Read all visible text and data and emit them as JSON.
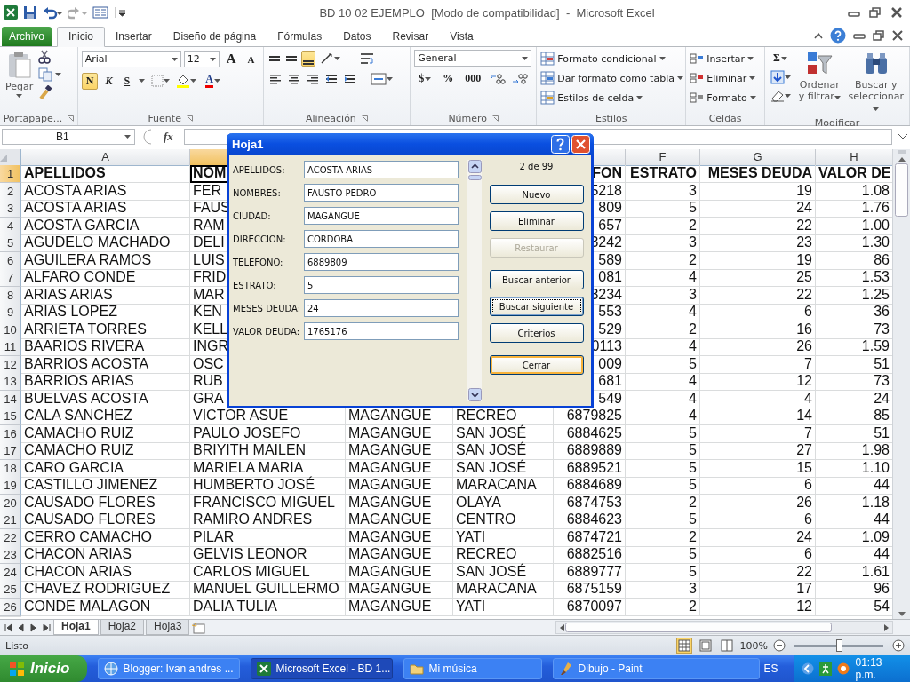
{
  "window": {
    "title": "BD 10 02 EJEMPLO  [Modo de compatibilidad]  -  Microsoft Excel"
  },
  "ribbon_tabs": [
    {
      "label": "Archivo",
      "kind": "file"
    },
    {
      "label": "Inicio",
      "kind": "tab",
      "selected": true
    },
    {
      "label": "Insertar",
      "kind": "tab",
      "selected": false
    },
    {
      "label": "Diseño de página",
      "kind": "tab",
      "selected": false
    },
    {
      "label": "Fórmulas",
      "kind": "tab",
      "selected": false
    },
    {
      "label": "Datos",
      "kind": "tab",
      "selected": false
    },
    {
      "label": "Revisar",
      "kind": "tab",
      "selected": false
    },
    {
      "label": "Vista",
      "kind": "tab",
      "selected": false
    }
  ],
  "ribbon": {
    "clipboard": {
      "label": "Portapape...",
      "paste": "Pegar"
    },
    "font": {
      "label": "Fuente",
      "name": "Arial",
      "size": "12",
      "grow": "A",
      "shrink": "A",
      "bold": "N",
      "bold_on": true,
      "italic": "K",
      "underline": "S",
      "color_glyph": "A"
    },
    "alignment": {
      "label": "Alineación",
      "bottom_align_on": true
    },
    "number": {
      "label": "Número",
      "format": "General",
      "currency": "$",
      "percent": "%",
      "thousands": "000"
    },
    "styles": {
      "label": "Estilos",
      "items": [
        "Formato condicional",
        "Dar formato como tabla",
        "Estilos de celda"
      ]
    },
    "cells": {
      "label": "Celdas",
      "items": [
        "Insertar",
        "Eliminar",
        "Formato"
      ]
    },
    "editing": {
      "label": "Modificar",
      "sum": "Σ",
      "sort": "Ordenar y filtrar",
      "find": "Buscar y seleccionar"
    }
  },
  "formula_bar": {
    "name_box": "B1",
    "function_label": "fx"
  },
  "sheet": {
    "columns": [
      {
        "label": "A",
        "selected": false
      },
      {
        "selected": true
      },
      {},
      {},
      {
        "selected": false
      },
      {
        "label": "F",
        "selected": false
      },
      {
        "label": "G",
        "selected": false
      },
      {
        "label": "H",
        "selected": false
      }
    ],
    "header_row": {
      "n": "1",
      "selected": true,
      "a": "APELLIDOS",
      "b": "NOM",
      "e": "FON",
      "f": "ESTRATO",
      "g": "MESES DEUDA",
      "h": "VALOR DE"
    },
    "rows": [
      {
        "n": "2",
        "selected": false,
        "a": "ACOSTA ARIAS",
        "b": "FER",
        "e": "5218",
        "f": "3",
        "g": "19",
        "h": "1.08"
      },
      {
        "n": "3",
        "selected": false,
        "a": "ACOSTA ARIAS",
        "b": "FAUS",
        "e": "809",
        "f": "5",
        "g": "24",
        "h": "1.76"
      },
      {
        "n": "4",
        "selected": false,
        "a": "ACOSTA GARCIA",
        "b": "RAM",
        "e": "657",
        "f": "2",
        "g": "22",
        "h": "1.00"
      },
      {
        "n": "5",
        "selected": false,
        "a": "AGUDELO MACHADO",
        "b": "DELI",
        "e": "3242",
        "f": "3",
        "g": "23",
        "h": "1.30"
      },
      {
        "n": "6",
        "selected": false,
        "a": "AGUILERA RAMOS",
        "b": "LUIS",
        "e": "589",
        "f": "2",
        "g": "19",
        "h": "86"
      },
      {
        "n": "7",
        "selected": false,
        "a": "ALFARO CONDE",
        "b": "FRID",
        "e": "081",
        "f": "4",
        "g": "25",
        "h": "1.53"
      },
      {
        "n": "8",
        "selected": false,
        "a": "ARIAS ARIAS",
        "b": "MAR",
        "e": "3234",
        "f": "3",
        "g": "22",
        "h": "1.25"
      },
      {
        "n": "9",
        "selected": false,
        "a": "ARIAS LOPEZ",
        "b": "KEN",
        "e": "553",
        "f": "4",
        "g": "6",
        "h": "36"
      },
      {
        "n": "10",
        "selected": false,
        "a": "ARRIETA TORRES",
        "b": "KELL",
        "e": "529",
        "f": "2",
        "g": "16",
        "h": "73"
      },
      {
        "n": "11",
        "selected": false,
        "a": "BAARIOS RIVERA",
        "b": "INGR",
        "e": "0113",
        "f": "4",
        "g": "26",
        "h": "1.59"
      },
      {
        "n": "12",
        "selected": false,
        "a": "BARRIOS ACOSTA",
        "b": "OSC",
        "e": "009",
        "f": "5",
        "g": "7",
        "h": "51"
      },
      {
        "n": "13",
        "selected": false,
        "a": "BARRIOS ARIAS",
        "b": "RUB",
        "e": "681",
        "f": "4",
        "g": "12",
        "h": "73"
      },
      {
        "n": "14",
        "selected": false,
        "a": "BUELVAS ACOSTA",
        "b": "GRA",
        "e": "549",
        "f": "4",
        "g": "4",
        "h": "24"
      },
      {
        "n": "15",
        "selected": false,
        "a": "CALA SANCHEZ",
        "b": "VICTOR ASUE",
        "c": "MAGANGUE",
        "d": "RECREO",
        "e": "6879825",
        "f": "4",
        "g": "14",
        "h": "85"
      },
      {
        "n": "16",
        "selected": false,
        "a": "CAMACHO RUIZ",
        "b": "PAULO JOSEFO",
        "c": "MAGANGUE",
        "d": "SAN JOSÉ",
        "e": "6884625",
        "f": "5",
        "g": "7",
        "h": "51"
      },
      {
        "n": "17",
        "selected": false,
        "a": "CAMACHO RUIZ",
        "b": "BRIYITH MAILEN",
        "c": "MAGANGUE",
        "d": "SAN JOSÉ",
        "e": "6889889",
        "f": "5",
        "g": "27",
        "h": "1.98"
      },
      {
        "n": "18",
        "selected": false,
        "a": "CARO GARCIA",
        "b": "MARIELA MARIA",
        "c": "MAGANGUE",
        "d": "SAN JOSÉ",
        "e": "6889521",
        "f": "5",
        "g": "15",
        "h": "1.10"
      },
      {
        "n": "19",
        "selected": false,
        "a": "CASTILLO JIMENEZ",
        "b": "HUMBERTO JOSÉ",
        "c": "MAGANGUE",
        "d": "MARACANA",
        "e": "6884689",
        "f": "5",
        "g": "6",
        "h": "44"
      },
      {
        "n": "20",
        "selected": false,
        "a": "CAUSADO FLORES",
        "b": "FRANCISCO MIGUEL",
        "c": "MAGANGUE",
        "d": "OLAYA",
        "e": "6874753",
        "f": "2",
        "g": "26",
        "h": "1.18"
      },
      {
        "n": "21",
        "selected": false,
        "a": "CAUSADO FLORES",
        "b": "RAMIRO ANDRES",
        "c": "MAGANGUE",
        "d": "CENTRO",
        "e": "6884623",
        "f": "5",
        "g": "6",
        "h": "44"
      },
      {
        "n": "22",
        "selected": false,
        "a": "CERRO CAMACHO",
        "b": "PILAR",
        "c": "MAGANGUE",
        "d": "YATI",
        "e": "6874721",
        "f": "2",
        "g": "24",
        "h": "1.09"
      },
      {
        "n": "23",
        "selected": false,
        "a": "CHACON ARIAS",
        "b": "GELVIS LEONOR",
        "c": "MAGANGUE",
        "d": "RECREO",
        "e": "6882516",
        "f": "5",
        "g": "6",
        "h": "44"
      },
      {
        "n": "24",
        "selected": false,
        "a": "CHACON ARIAS",
        "b": "CARLOS MIGUEL",
        "c": "MAGANGUE",
        "d": "SAN JOSÉ",
        "e": "6889777",
        "f": "5",
        "g": "22",
        "h": "1.61"
      },
      {
        "n": "25",
        "selected": false,
        "a": "CHAVEZ RODRIGUEZ",
        "b": "MANUEL GUILLERMO",
        "c": "MAGANGUE",
        "d": "MARACANA",
        "e": "6875159",
        "f": "3",
        "g": "17",
        "h": "96"
      },
      {
        "n": "26",
        "selected": false,
        "a": "CONDE MALAGON",
        "b": "DALIA TULIA",
        "c": "MAGANGUE",
        "d": "YATI",
        "e": "6870097",
        "f": "2",
        "g": "12",
        "h": "54"
      }
    ]
  },
  "dialog": {
    "title": "Hoja1",
    "record": "2 de 99",
    "fields": [
      {
        "label": "APELLIDOS:",
        "value": "ACOSTA ARIAS"
      },
      {
        "label": "NOMBRES:",
        "value": "FAUSTO PEDRO"
      },
      {
        "label": "CIUDAD:",
        "value": "MAGANGUE"
      },
      {
        "label": "DIRECCION:",
        "value": "CORDOBA"
      },
      {
        "label": "TELEFONO:",
        "value": "6889809"
      },
      {
        "label": "ESTRATO:",
        "value": "5"
      },
      {
        "label": "MESES DEUDA:",
        "value": "24"
      },
      {
        "label": "VALOR DEUDA:",
        "value": "1765176"
      }
    ],
    "button_groups": [
      [
        {
          "label": "Nuevo",
          "disabled": false,
          "focused": false,
          "default": false
        },
        {
          "label": "Eliminar",
          "disabled": false,
          "focused": false,
          "default": false
        },
        {
          "label": "Restaurar",
          "disabled": true,
          "focused": false,
          "default": false
        }
      ],
      [
        {
          "label": "Buscar anterior",
          "disabled": false,
          "focused": false,
          "default": false
        },
        {
          "label": "Buscar siguiente",
          "disabled": false,
          "focused": true,
          "default": false
        },
        {
          "label": "Criterios",
          "disabled": false,
          "focused": false,
          "default": false
        }
      ],
      [
        {
          "label": "Cerrar",
          "disabled": false,
          "focused": false,
          "default": true
        }
      ]
    ]
  },
  "sheet_tabs": [
    {
      "label": "Hoja1",
      "selected": true
    },
    {
      "label": "Hoja2",
      "selected": false
    },
    {
      "label": "Hoja3",
      "selected": false
    }
  ],
  "status_bar": {
    "text": "Listo",
    "zoom": "100%",
    "zoom_slider": {
      "level": 0.5
    }
  },
  "taskbar": {
    "start": "Inicio",
    "tasks": [
      {
        "label": "Blogger: Ivan andres ...",
        "selected": false
      },
      {
        "label": "Microsoft Excel - BD 1...",
        "selected": true
      },
      {
        "label": "Mi música",
        "selected": false
      },
      {
        "label": "Dibujo - Paint",
        "selected": false
      }
    ],
    "language": "ES",
    "clock": "01:13 p.m."
  }
}
